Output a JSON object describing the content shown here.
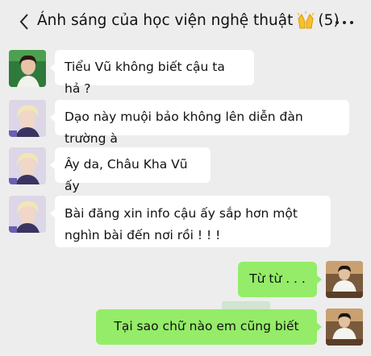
{
  "header": {
    "title": "Ánh sáng của học viện nghệ thuật",
    "title_emoji": "raising-hands-emoji",
    "member_count": "(5)",
    "back_icon": "chevron-left-icon",
    "more_icon": "more-dots-icon"
  },
  "messages": [
    {
      "side": "left",
      "text": "Tiểu Vũ không biết cậu ta hả ?",
      "avatar": "avatar-girl-green"
    },
    {
      "side": "left",
      "text": "Dạo này muội bảo không lên diễn đàn trường à",
      "avatar": "avatar-boy-blonde"
    },
    {
      "side": "left",
      "text": "Ây da, Châu Kha Vũ ấy",
      "avatar": "avatar-boy-blonde"
    },
    {
      "side": "left",
      "text": "Bài đăng xin info cậu ấy sắp hơn một nghìn bài đến nơi rồi ! ! !",
      "avatar": "avatar-boy-blonde"
    },
    {
      "side": "right",
      "text": "Từ từ . . .",
      "avatar": "avatar-boy-seated"
    },
    {
      "side": "right",
      "text": "Tại sao chữ nào em cũng biết",
      "avatar": "avatar-boy-seated"
    }
  ],
  "colors": {
    "background": "#ededed",
    "bubble_left": "#ffffff",
    "bubble_right": "#95ec69"
  }
}
